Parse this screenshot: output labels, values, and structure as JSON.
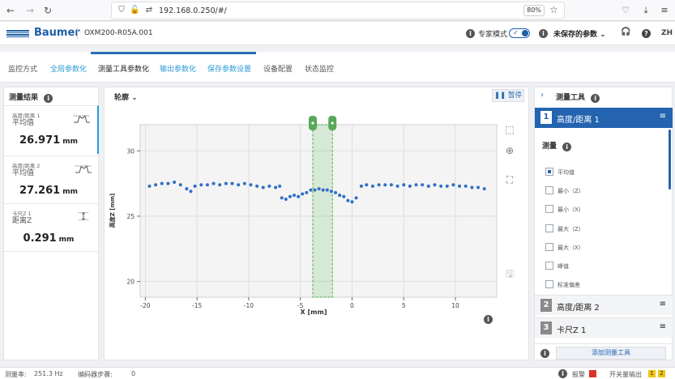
{
  "browser": {
    "url": "192.168.0.250/#/",
    "zoom": "80%",
    "nav_back": "←",
    "nav_forward": "→",
    "nav_reload": "↻"
  },
  "header": {
    "brand": "Baumer",
    "device": "OXM200-R05A.001",
    "expert_mode_label": "专家模式",
    "unsaved_label": "未保存的参数",
    "lang": "ZH"
  },
  "tabs": [
    {
      "label": "监控方式"
    },
    {
      "label": "全局参数化"
    },
    {
      "label": "测量工具参数化"
    },
    {
      "label": "输出参数化"
    },
    {
      "label": "保存参数设置"
    },
    {
      "label": "设备配置"
    },
    {
      "label": "状态监控"
    }
  ],
  "results": {
    "title": "测量结果",
    "items": [
      {
        "caption": "高度/距离 1",
        "sub": "平均值",
        "value": "26.971",
        "unit": "mm"
      },
      {
        "caption": "高度/距离 2",
        "sub": "平均值",
        "value": "27.261",
        "unit": "mm"
      },
      {
        "caption": "卡尺Z 1",
        "sub": "距离Z",
        "value": "0.291",
        "unit": "mm"
      }
    ]
  },
  "center": {
    "profile_label": "轮廓",
    "pause_label": "暂停"
  },
  "chart_data": {
    "type": "scatter",
    "xlabel": "X [mm]",
    "ylabel": "高度Z [mm]",
    "xlim": [
      -20.5,
      14
    ],
    "ylim": [
      18.8,
      32
    ],
    "xticks": [
      -20,
      -15,
      -10,
      -5,
      0,
      5,
      10
    ],
    "yticks": [
      20,
      25,
      30
    ],
    "roi": {
      "x_from": -3.8,
      "x_to": -1.9
    },
    "series": [
      {
        "color": "#2f6fc4",
        "points": [
          [
            -19.6,
            27.3
          ],
          [
            -19.0,
            27.4
          ],
          [
            -18.4,
            27.5
          ],
          [
            -17.8,
            27.5
          ],
          [
            -17.2,
            27.6
          ],
          [
            -16.6,
            27.4
          ],
          [
            -16.0,
            27.1
          ],
          [
            -15.6,
            26.9
          ],
          [
            -15.2,
            27.3
          ],
          [
            -14.6,
            27.4
          ],
          [
            -14.0,
            27.4
          ],
          [
            -13.4,
            27.5
          ],
          [
            -12.8,
            27.4
          ],
          [
            -12.2,
            27.5
          ],
          [
            -11.6,
            27.5
          ],
          [
            -11.0,
            27.4
          ],
          [
            -10.4,
            27.5
          ],
          [
            -9.8,
            27.4
          ],
          [
            -9.2,
            27.3
          ],
          [
            -8.6,
            27.2
          ],
          [
            -8.0,
            27.3
          ],
          [
            -7.4,
            27.2
          ],
          [
            -7.0,
            27.3
          ],
          [
            -6.8,
            26.4
          ],
          [
            -6.4,
            26.3
          ],
          [
            -6.0,
            26.5
          ],
          [
            -5.6,
            26.6
          ],
          [
            -5.2,
            26.5
          ],
          [
            -4.8,
            26.7
          ],
          [
            -4.4,
            26.8
          ],
          [
            -4.0,
            27.0
          ],
          [
            -3.6,
            27.0
          ],
          [
            -3.2,
            27.1
          ],
          [
            -2.8,
            27.0
          ],
          [
            -2.4,
            27.0
          ],
          [
            -2.0,
            26.9
          ],
          [
            -1.6,
            26.8
          ],
          [
            -1.2,
            26.6
          ],
          [
            -0.8,
            26.5
          ],
          [
            -0.4,
            26.2
          ],
          [
            0.0,
            26.1
          ],
          [
            0.4,
            26.4
          ],
          [
            0.9,
            27.3
          ],
          [
            1.4,
            27.4
          ],
          [
            2.0,
            27.3
          ],
          [
            2.6,
            27.4
          ],
          [
            3.2,
            27.4
          ],
          [
            3.8,
            27.4
          ],
          [
            4.4,
            27.3
          ],
          [
            5.0,
            27.4
          ],
          [
            5.6,
            27.3
          ],
          [
            6.2,
            27.4
          ],
          [
            6.8,
            27.4
          ],
          [
            7.4,
            27.3
          ],
          [
            8.0,
            27.4
          ],
          [
            8.6,
            27.3
          ],
          [
            9.2,
            27.3
          ],
          [
            9.8,
            27.4
          ],
          [
            10.4,
            27.3
          ],
          [
            11.0,
            27.3
          ],
          [
            11.6,
            27.2
          ],
          [
            12.2,
            27.2
          ],
          [
            12.8,
            27.1
          ]
        ]
      }
    ]
  },
  "tools": {
    "title": "测量工具",
    "measure_label": "测量",
    "items": [
      {
        "num": "1",
        "label": "高度/距离 1"
      },
      {
        "num": "2",
        "label": "高度/距离 2"
      },
      {
        "num": "3",
        "label": "卡尺Z 1"
      }
    ],
    "options": [
      {
        "label": "平均值",
        "checked": true
      },
      {
        "label": "最小（Z）",
        "checked": false
      },
      {
        "label": "最小（X）",
        "checked": false
      },
      {
        "label": "最大（Z）",
        "checked": false
      },
      {
        "label": "最大（X）",
        "checked": false
      },
      {
        "label": "峰值",
        "checked": false
      },
      {
        "label": "标准偏差",
        "checked": false
      }
    ],
    "add_label": "添加测量工具"
  },
  "footer": {
    "rate_label": "测量率:",
    "rate_value": "251.3 Hz",
    "encoder_label": "编码器步骤:",
    "encoder_value": "0",
    "alarm_label": "报警",
    "switch_label": "开关量输出",
    "switch_1": "1",
    "switch_2": "2"
  },
  "colors": {
    "brand": "#1d5ea8",
    "accent": "#2463b0",
    "link": "#2a9ad6",
    "plot": "#2f6fc4",
    "roi": "#4caf50"
  }
}
